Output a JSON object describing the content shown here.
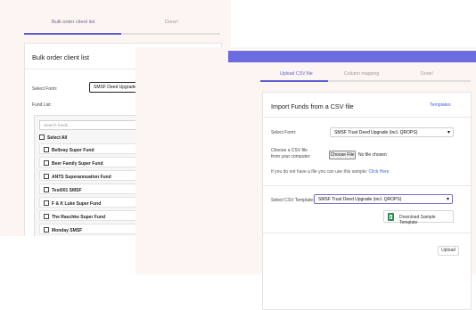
{
  "left_window": {
    "steps": [
      "Bulk order client list",
      "Done!"
    ],
    "card_title": "Bulk order client list",
    "select_form_label": "Select Form:",
    "select_form_value": "SMSF Deed Upgrade - Deed of Variation",
    "fund_list_label": "Fund List:",
    "search_placeholder": "Search funds...",
    "select_all_label": "Select All",
    "funds": [
      "Belbray Super Fund",
      "Beer Family Super Fund",
      "ANTS Superannuation Fund",
      "Test001 SMSF",
      "F & K Luke Super Fund",
      "The Raschke Super Fund",
      "Monday SMSF"
    ]
  },
  "right_window": {
    "steps": [
      "Upload CSV file",
      "Column mapping",
      "Done!"
    ],
    "card_title": "Import Funds from a CSV file",
    "templates_link": "Templates",
    "select_form_label": "Select Form:",
    "select_form_value": "SMSF Trust Deed Upgrade (incl. QROPS)",
    "choose_csv_label_1": "Choose a CSV file",
    "choose_csv_label_2": "from your computer:",
    "choose_file_button": "Choose File",
    "no_file_text": "No file chosen",
    "sample_text": "If you do not have a file you can use this sample:",
    "sample_link": "Click Here",
    "select_template_label": "Select CSV Template:",
    "select_template_value": "SMSF Trust Deed Upgrade (incl. QROPS)",
    "download_button": "Download Sample Template",
    "upload_button": "Upload"
  },
  "colors": {
    "accent": "#5d5fd3",
    "top_bar": "#6c6be0",
    "link": "#3c63d6",
    "excel_green": "#2e8b57",
    "page_bg": "#fcf5f2"
  }
}
